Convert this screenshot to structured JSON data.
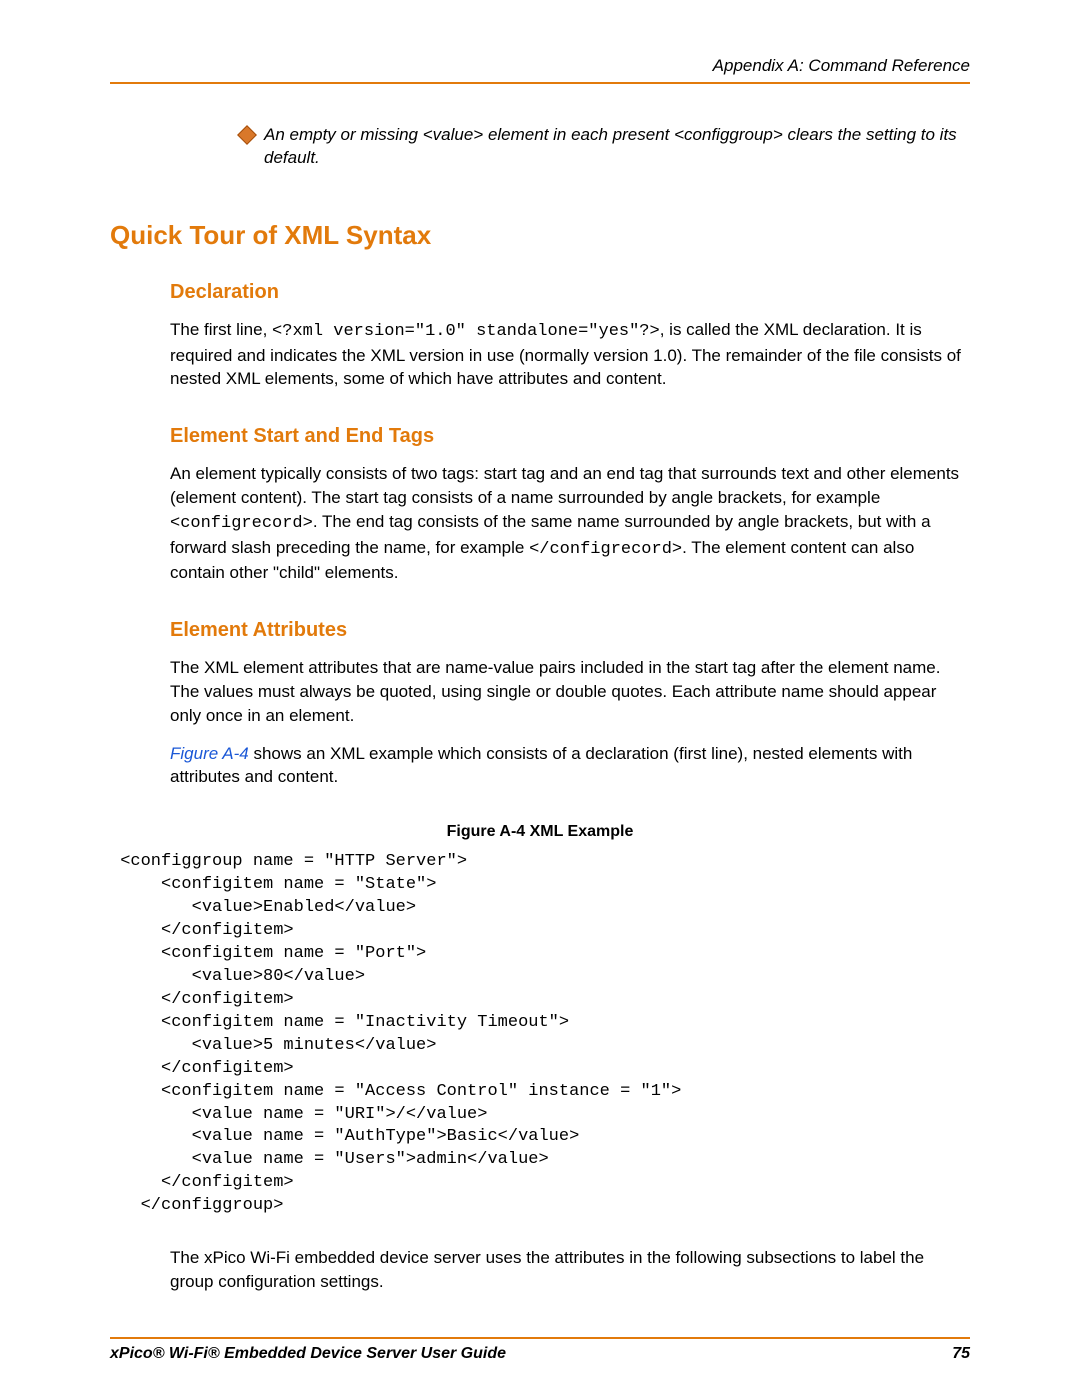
{
  "header": {
    "running": "Appendix A: Command Reference"
  },
  "bullet": {
    "text": "An empty or missing <value> element in each present <configgroup> clears the setting to its default."
  },
  "h1": "Quick Tour of XML Syntax",
  "declaration": {
    "title": "Declaration",
    "pre": "The first line, ",
    "code": "<?xml version=\"1.0\" standalone=\"yes\"?>",
    "post": ", is called the XML declaration. It is required and indicates the XML version in use (normally version 1.0).  The remainder of the file consists of nested XML elements, some of which have attributes and content."
  },
  "tags": {
    "title": "Element Start and End Tags",
    "p1a": "An element typically consists of two tags: start tag and an end tag that surrounds text and other elements (element content).  The start tag consists of a name surrounded by angle brackets, for example ",
    "code1": "<configrecord>",
    "p1b": ".  The end tag consists of the same name surrounded by angle brackets, but with a forward slash preceding the name, for example ",
    "code2": "</configrecord>",
    "p1c": ".  The element content can also contain other \"child\" elements."
  },
  "attrs": {
    "title": "Element Attributes",
    "p1": "The XML element attributes that are name-value pairs included in the start tag after the element name.  The values must always be quoted, using single or double quotes.  Each attribute name should appear only once in an element.",
    "p2ref": "Figure A-4",
    "p2rest": " shows an XML example which consists of a declaration (first line), nested elements with attributes and content."
  },
  "figure": {
    "caption": "Figure A-4  XML Example",
    "code": " <configgroup name = \"HTTP Server\">\n     <configitem name = \"State\">\n        <value>Enabled</value>\n     </configitem>\n     <configitem name = \"Port\">\n        <value>80</value>\n     </configitem>\n     <configitem name = \"Inactivity Timeout\">\n        <value>5 minutes</value>\n     </configitem>\n     <configitem name = \"Access Control\" instance = \"1\">\n        <value name = \"URI\">/</value>\n        <value name = \"AuthType\">Basic</value>\n        <value name = \"Users\">admin</value>\n     </configitem>\n   </configgroup>"
  },
  "closing": {
    "p": "The xPico Wi-Fi embedded device server uses the attributes in the following subsections to label the group configuration settings."
  },
  "footer": {
    "title": "xPico® Wi-Fi® Embedded Device Server User Guide",
    "page": "75"
  }
}
